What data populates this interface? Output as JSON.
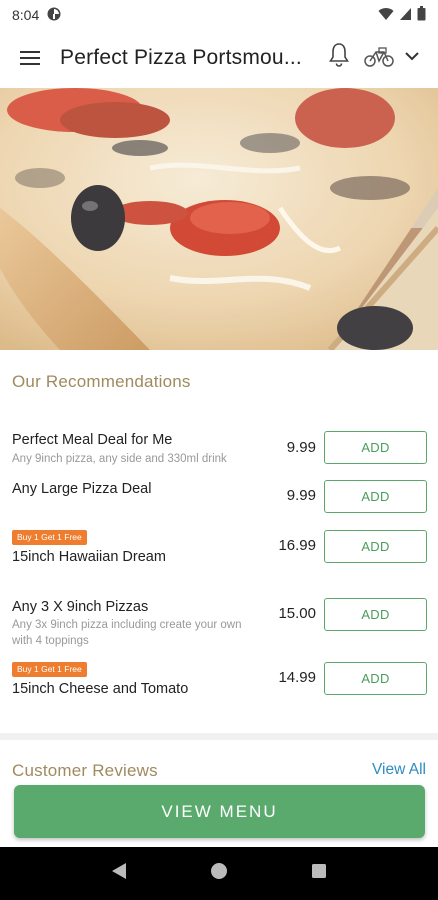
{
  "status": {
    "time": "8:04"
  },
  "header": {
    "title": "Perfect Pizza Portsmou..."
  },
  "icons": {
    "menu": "hamburger-menu-icon",
    "notifications": "bell-icon",
    "delivery": "bicycle-icon",
    "dropdown": "chevron-down-icon"
  },
  "recommendations": {
    "title": "Our Recommendations",
    "add_label": "ADD",
    "items": [
      {
        "name": "Perfect Meal Deal for Me",
        "description": "Any 9inch pizza, any side and 330ml drink",
        "price": "9.99",
        "badge": ""
      },
      {
        "name": "Any Large Pizza Deal",
        "description": "",
        "price": "9.99",
        "badge": ""
      },
      {
        "name": "15inch Hawaiian Dream",
        "description": "",
        "price": "16.99",
        "badge": "Buy 1 Get 1 Free"
      },
      {
        "name": "Any 3 X 9inch Pizzas",
        "description": "Any 3x 9inch pizza including create your own with 4 toppings",
        "price": "15.00",
        "badge": ""
      },
      {
        "name": "15inch Cheese and Tomato",
        "description": "",
        "price": "14.99",
        "badge": "Buy 1 Get 1 Free"
      }
    ]
  },
  "reviews": {
    "title": "Customer Reviews",
    "view_all": "View All"
  },
  "cta": {
    "label": "VIEW MENU"
  },
  "colors": {
    "accent_green": "#5aaa6e",
    "badge_orange": "#ef7d2f",
    "section_gold": "#a08a5f",
    "link_blue": "#2e8dc1"
  }
}
